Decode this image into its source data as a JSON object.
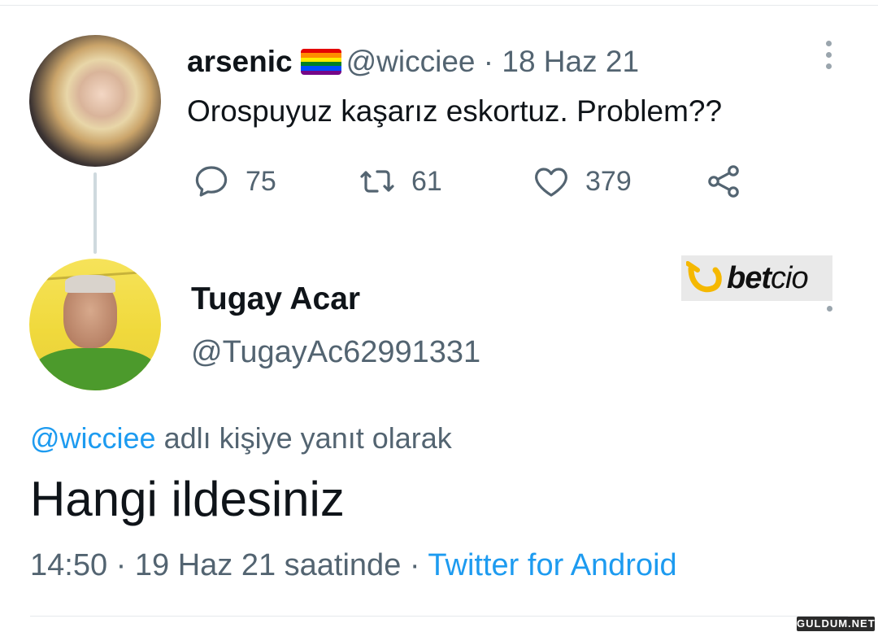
{
  "parent_tweet": {
    "display_name": "arsenic",
    "flag_icon": "rainbow-flag-icon",
    "handle": "@wicciee",
    "separator": "·",
    "date": "18 Haz 21",
    "text": "Orospuyuz kaşarız eskortuz. Problem??",
    "more_icon": "more-vertical-icon",
    "stats": {
      "replies": "75",
      "retweets": "61",
      "likes": "379"
    },
    "icons": {
      "reply": "reply-icon",
      "retweet": "retweet-icon",
      "like": "heart-icon",
      "share": "share-icon"
    }
  },
  "ad_logo": {
    "bet": "bet",
    "cio": "cio",
    "accent_color": "#f5b800"
  },
  "reply_tweet": {
    "display_name": "Tugay Acar",
    "handle": "@TugayAc62991331",
    "mention": "@wicciee",
    "reply_context": "adlı kişiye yanıt olarak",
    "text": "Hangi ildesiniz",
    "time": "14:50",
    "separator": "·",
    "date_label": "19 Haz 21 saatinde",
    "source": "Twitter for Android"
  },
  "watermark": "GULDUM.NET",
  "colors": {
    "link_blue": "#1d9bf0",
    "secondary_text": "#536471",
    "primary_text": "#0f1419"
  }
}
